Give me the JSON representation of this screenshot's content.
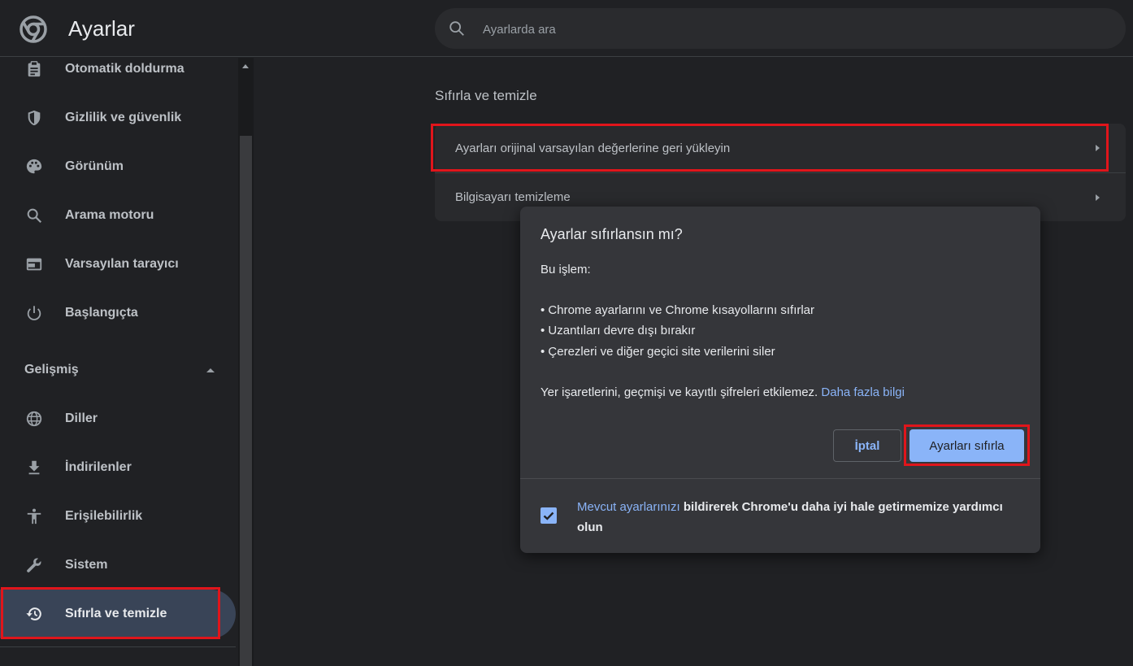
{
  "header": {
    "title": "Ayarlar",
    "search_placeholder": "Ayarlarda ara"
  },
  "sidebar": {
    "items": [
      {
        "label": "Otomatik doldurma",
        "icon": "clipboard-icon"
      },
      {
        "label": "Gizlilik ve güvenlik",
        "icon": "shield-icon"
      },
      {
        "label": "Görünüm",
        "icon": "palette-icon"
      },
      {
        "label": "Arama motoru",
        "icon": "search-icon"
      },
      {
        "label": "Varsayılan tarayıcı",
        "icon": "browser-window-icon"
      },
      {
        "label": "Başlangıçta",
        "icon": "power-icon"
      }
    ],
    "advanced_label": "Gelişmiş",
    "advanced_items": [
      {
        "label": "Diller",
        "icon": "globe-icon"
      },
      {
        "label": "İndirilenler",
        "icon": "download-icon"
      },
      {
        "label": "Erişilebilirlik",
        "icon": "accessibility-icon"
      },
      {
        "label": "Sistem",
        "icon": "wrench-icon"
      },
      {
        "label": "Sıfırla ve temizle",
        "icon": "restore-history-icon"
      }
    ]
  },
  "main": {
    "section_title": "Sıfırla ve temizle",
    "rows": [
      {
        "label": "Ayarları orijinal varsayılan değerlerine geri yükleyin"
      },
      {
        "label": "Bilgisayarı temizleme"
      }
    ]
  },
  "dialog": {
    "title": "Ayarlar sıfırlansın mı?",
    "intro": "Bu işlem:",
    "bullets": [
      "• Chrome ayarlarını ve Chrome kısayollarını sıfırlar",
      "• Uzantıları devre dışı bırakır",
      "• Çerezleri ve diğer geçici site verilerini siler"
    ],
    "note": "Yer işaretlerini, geçmişi ve kayıtlı şifreleri etkilemez.",
    "learn_more": "Daha fazla bilgi",
    "cancel_label": "İptal",
    "reset_label": "Ayarları sıfırla",
    "footer_link": "Mevcut ayarlarınızı",
    "footer_text": " bildirerek Chrome'u daha iyi hale getirmemize yardımcı olun",
    "footer_checked": true
  },
  "colors": {
    "accent": "#8ab4f8",
    "highlight": "#e0151b",
    "background": "#202124",
    "dialog_bg": "#35363a"
  }
}
